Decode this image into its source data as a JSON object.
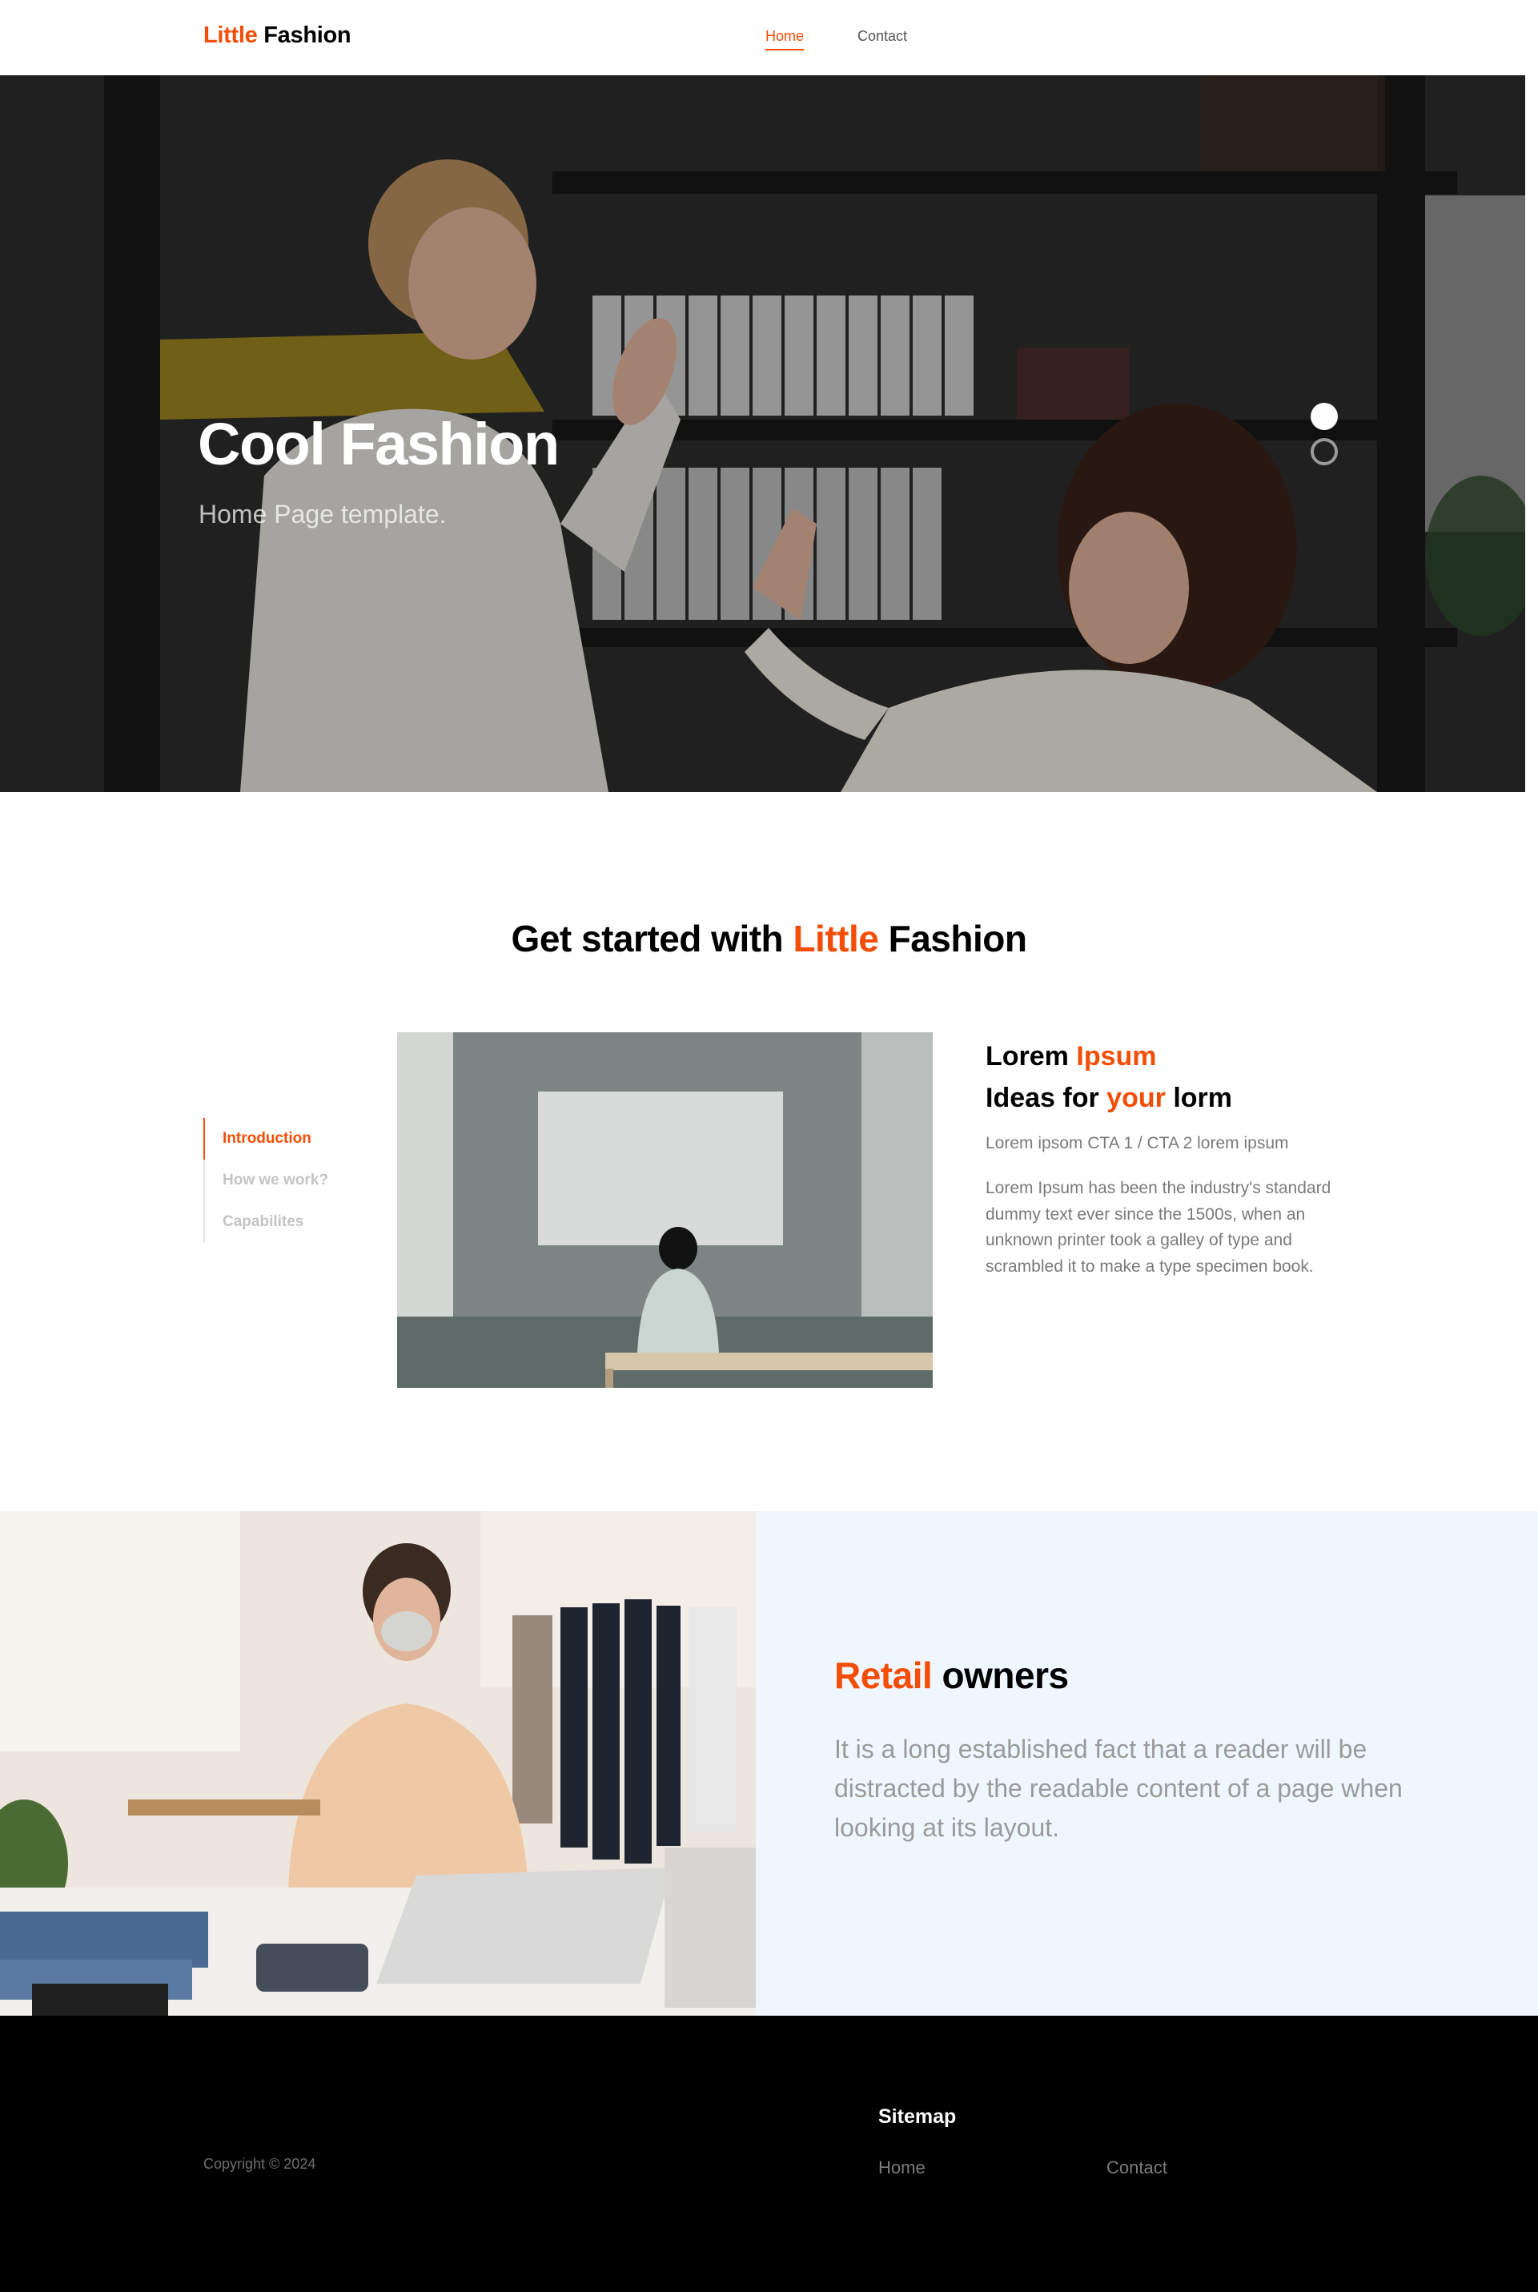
{
  "nav": {
    "brand_accent": "Little",
    "brand_rest": "Fashion",
    "links": [
      {
        "label": "Home",
        "active": true
      },
      {
        "label": "Contact",
        "active": false
      }
    ]
  },
  "hero": {
    "title": "Cool Fashion",
    "subtitle": "Home Page template.",
    "carousel": {
      "slides": 2,
      "active_index": 0
    }
  },
  "get_started": {
    "title_pre": "Get started with",
    "title_accent": "Little",
    "title_post": "Fashion",
    "tabs": [
      {
        "label": "Introduction",
        "active": true
      },
      {
        "label": "How we work?",
        "active": false
      },
      {
        "label": "Capabilites",
        "active": false
      }
    ],
    "heading_line1_pre": "Lorem",
    "heading_line1_accent": "Ipsum",
    "heading_line2_pre": "Ideas for",
    "heading_line2_accent": "your",
    "heading_line2_post": "lorm",
    "cta_text": "Lorem ipsom CTA 1 / CTA 2 lorem ipsum",
    "body": "Lorem Ipsum has been the industry's standard dummy text ever since the 1500s, when an unknown printer took a galley of type and scrambled it to make a type specimen book."
  },
  "retail": {
    "title_accent": "Retail",
    "title_rest": "owners",
    "body": "It is a long established fact that a reader will be distracted by the readable content of a page when looking at its layout."
  },
  "footer": {
    "copyright": "Copyright © 2024",
    "sitemap_title": "Sitemap",
    "links": [
      "Home",
      "Contact"
    ]
  },
  "colors": {
    "accent": "#f24e07",
    "retail_panel_bg": "#eff6fd",
    "footer_bg": "#000000"
  }
}
